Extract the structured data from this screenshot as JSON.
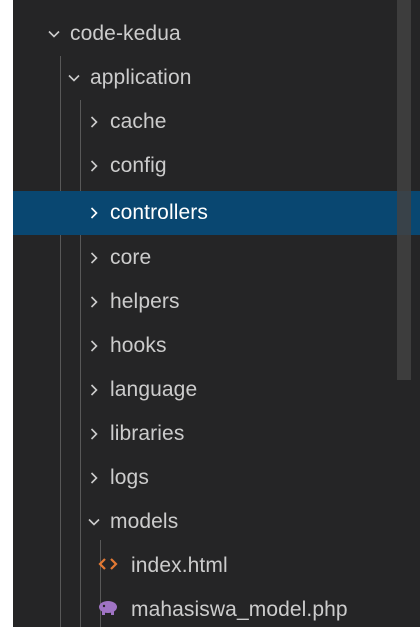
{
  "explorer": {
    "items": [
      {
        "label": "code-kedua",
        "type": "folder",
        "expanded": true,
        "selected": false,
        "icon": "chevron-down-icon"
      },
      {
        "label": "application",
        "type": "folder",
        "expanded": true,
        "selected": false,
        "icon": "chevron-down-icon"
      },
      {
        "label": "cache",
        "type": "folder",
        "expanded": false,
        "selected": false,
        "icon": "chevron-right-icon"
      },
      {
        "label": "config",
        "type": "folder",
        "expanded": false,
        "selected": false,
        "icon": "chevron-right-icon"
      },
      {
        "label": "controllers",
        "type": "folder",
        "expanded": false,
        "selected": true,
        "icon": "chevron-right-icon"
      },
      {
        "label": "core",
        "type": "folder",
        "expanded": false,
        "selected": false,
        "icon": "chevron-right-icon"
      },
      {
        "label": "helpers",
        "type": "folder",
        "expanded": false,
        "selected": false,
        "icon": "chevron-right-icon"
      },
      {
        "label": "hooks",
        "type": "folder",
        "expanded": false,
        "selected": false,
        "icon": "chevron-right-icon"
      },
      {
        "label": "language",
        "type": "folder",
        "expanded": false,
        "selected": false,
        "icon": "chevron-right-icon"
      },
      {
        "label": "libraries",
        "type": "folder",
        "expanded": false,
        "selected": false,
        "icon": "chevron-right-icon"
      },
      {
        "label": "logs",
        "type": "folder",
        "expanded": false,
        "selected": false,
        "icon": "chevron-right-icon"
      },
      {
        "label": "models",
        "type": "folder",
        "expanded": true,
        "selected": false,
        "icon": "chevron-down-icon"
      },
      {
        "label": "index.html",
        "type": "file",
        "selected": false,
        "icon": "html-file-icon"
      },
      {
        "label": "mahasiswa_model.php",
        "type": "file",
        "selected": false,
        "icon": "php-file-icon"
      }
    ]
  },
  "colors": {
    "background": "#252526",
    "selected_row": "#094771",
    "text": "#cccccc",
    "html_icon": "#e37933",
    "php_icon": "#a074c4",
    "scrollbar": "#424242"
  }
}
